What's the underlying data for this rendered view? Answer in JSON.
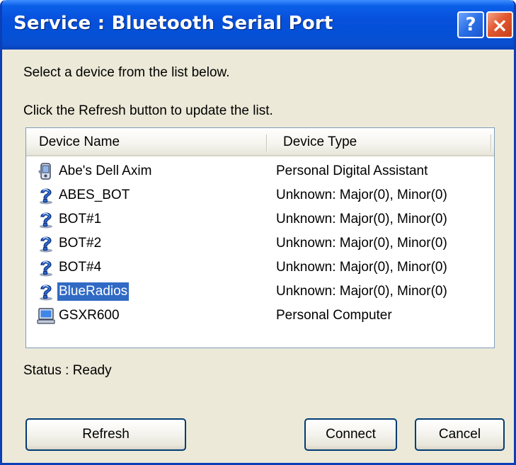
{
  "window": {
    "title": "Service : Bluetooth Serial Port",
    "help_glyph": "?",
    "close_glyph": "×",
    "title_bar_color": "#0a4ed0"
  },
  "instructions": {
    "line1": "Select a device from the list below.",
    "line2": "Click the Refresh button to update the list."
  },
  "device_list": {
    "columns": [
      "Device Name",
      "Device Type"
    ],
    "rows": [
      {
        "name": "Abe's Dell Axim",
        "type": "Personal Digital Assistant",
        "icon": "pda-icon",
        "selected": false
      },
      {
        "name": "ABES_BOT",
        "type": "Unknown: Major(0), Minor(0)",
        "icon": "unknown-device-icon",
        "selected": false
      },
      {
        "name": "BOT#1",
        "type": "Unknown: Major(0), Minor(0)",
        "icon": "unknown-device-icon",
        "selected": false
      },
      {
        "name": "BOT#2",
        "type": "Unknown: Major(0), Minor(0)",
        "icon": "unknown-device-icon",
        "selected": false
      },
      {
        "name": "BOT#4",
        "type": "Unknown: Major(0), Minor(0)",
        "icon": "unknown-device-icon",
        "selected": false
      },
      {
        "name": "BlueRadios",
        "type": "Unknown: Major(0), Minor(0)",
        "icon": "unknown-device-icon",
        "selected": true
      },
      {
        "name": "GSXR600",
        "type": "Personal Computer",
        "icon": "computer-icon",
        "selected": false
      }
    ],
    "selection_color": "#316ac5"
  },
  "status": {
    "text": "Status : Ready"
  },
  "buttons": {
    "refresh": "Refresh",
    "connect": "Connect",
    "cancel": "Cancel"
  }
}
